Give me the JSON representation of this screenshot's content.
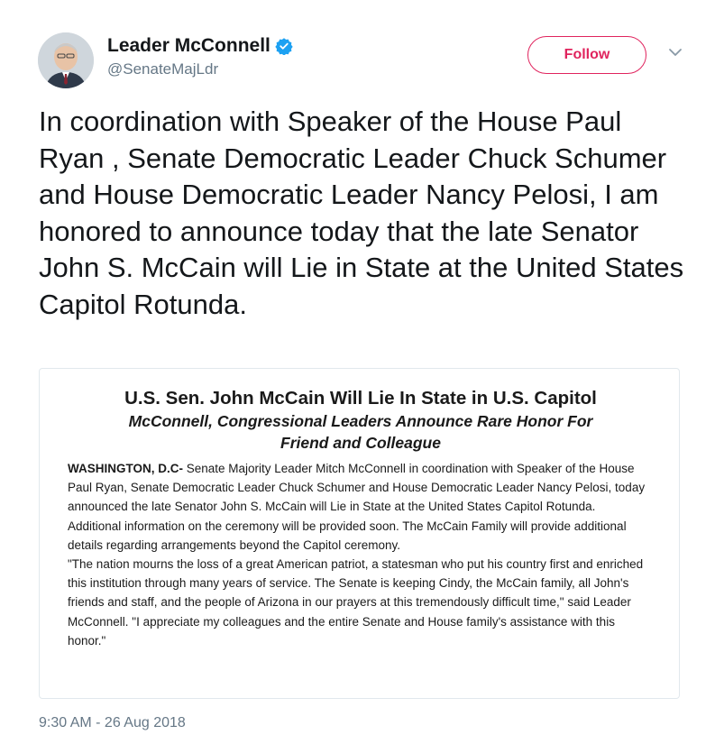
{
  "author": {
    "display_name": "Leader McConnell",
    "handle": "@SenateMajLdr",
    "verified_icon": "verified-badge-icon"
  },
  "actions": {
    "follow_label": "Follow",
    "menu_icon": "chevron-down-icon"
  },
  "tweet": {
    "text": "In coordination with Speaker of the House Paul Ryan , Senate Democratic Leader Chuck Schumer and House Democratic Leader Nancy Pelosi, I am honored to announce today that the late Senator John S. McCain will Lie in State at the United States Capitol Rotunda.",
    "timestamp": "9:30 AM - 26 Aug 2018"
  },
  "press_release": {
    "title": "U.S. Sen. John McCain Will Lie In State in U.S. Capitol",
    "subtitle": "McConnell, Congressional Leaders Announce Rare Honor For Friend and Colleague",
    "dateline": "WASHINGTON, D.C-",
    "paragraph_1": " Senate Majority Leader Mitch McConnell in coordination with Speaker of the House Paul Ryan, Senate Democratic Leader Chuck Schumer and House Democratic Leader Nancy Pelosi, today announced the late Senator John S. McCain will Lie in State at the United States Capitol Rotunda.",
    "paragraph_2": "Additional information on the ceremony will be provided soon. The McCain Family will provide additional details regarding arrangements beyond the Capitol ceremony.",
    "paragraph_3": "\"The nation mourns the loss of a great American patriot, a statesman who put his country first and enriched this institution through many years of service. The Senate is keeping Cindy, the McCain family, all John's friends and staff, and the people of Arizona in our prayers at this tremendously difficult time,\" said Leader McConnell. \"I appreciate my colleagues and the entire Senate and House family's assistance with this honor.\""
  },
  "colors": {
    "follow_accent": "#e0245e",
    "verified_blue": "#1da1f2",
    "secondary_text": "#657786"
  }
}
